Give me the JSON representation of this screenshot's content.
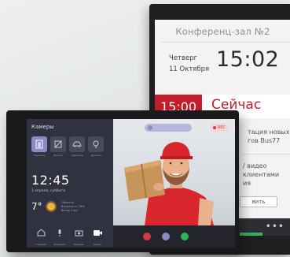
{
  "conference": {
    "title": "Конференц-зал №2",
    "day": "Четверг",
    "date": "11 Октября",
    "time": "15:02",
    "slot_time": "15:00",
    "slot_label": "Сейчас",
    "event_line1": "тация новых",
    "event_line2": "гов Bus77",
    "event2_line1": "/ видео",
    "event2_line2": "клиентами",
    "event2_line3": "ия",
    "button_label": "вить",
    "more": "•••",
    "colors": {
      "accent": "#c21e2b",
      "ok": "#34b15a"
    }
  },
  "intercom": {
    "panel_title": "Камеры",
    "tiles": [
      "Подъезд",
      "Ворота",
      "Парковка",
      "Детская"
    ],
    "time": "12:45",
    "date": "1 апреля, суббота",
    "temperature": "7°",
    "weather_line1": "Облачно",
    "weather_line2": "Влажность 76%",
    "weather_line3": "Ветер 3 м/с",
    "nav": [
      "Главная",
      "Домофон",
      "Камеры",
      "Видео"
    ],
    "rec_label": "REC",
    "colors": {
      "accent": "#8c87c6",
      "rec": "#d33b43"
    }
  }
}
